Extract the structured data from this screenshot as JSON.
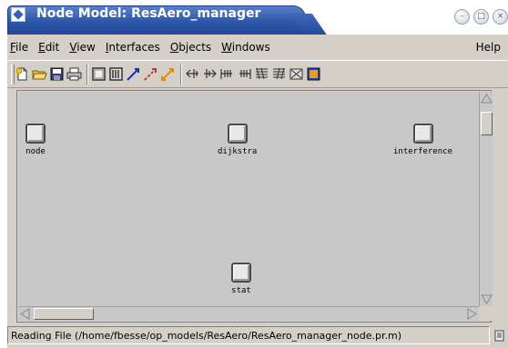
{
  "window": {
    "title": "Node Model: ResAero_manager",
    "controls": [
      "minimize",
      "maximize",
      "close"
    ]
  },
  "menu": {
    "items": [
      {
        "label": "File",
        "mnemonic": "F",
        "rest": "ile"
      },
      {
        "label": "Edit",
        "mnemonic": "E",
        "rest": "dit"
      },
      {
        "label": "View",
        "mnemonic": "V",
        "rest": "iew"
      },
      {
        "label": "Interfaces",
        "mnemonic": "I",
        "rest": "nterfaces"
      },
      {
        "label": "Objects",
        "mnemonic": "O",
        "rest": "bjects"
      },
      {
        "label": "Windows",
        "mnemonic": "W",
        "rest": "indows"
      }
    ],
    "help": {
      "label": "Help",
      "mnemonic": "H",
      "rest": "elp"
    }
  },
  "toolbar": {
    "buttons": [
      "new-file-icon",
      "open-folder-icon",
      "save-icon",
      "print-icon",
      "processor-module-icon",
      "queue-module-icon",
      "packet-stream-icon",
      "statistic-wire-icon",
      "logical-association-icon",
      "point-to-point-transmitter-icon",
      "point-to-point-receiver-icon",
      "bus-transmitter-icon",
      "bus-receiver-icon",
      "radio-transmitter-icon",
      "radio-receiver-icon",
      "antenna-icon",
      "external-system-icon"
    ]
  },
  "canvas": {
    "nodes": [
      {
        "label": "node"
      },
      {
        "label": "dijkstra"
      },
      {
        "label": "interference"
      },
      {
        "label": "stat"
      }
    ]
  },
  "status": {
    "text": "Reading File (/home/fbesse/op_models/ResAero/ResAero_manager_node.pr.m)"
  },
  "colors": {
    "title_bar": "#2d56a8",
    "window_bg": "#d4d0c8",
    "canvas_bg": "#c8c8c8"
  }
}
